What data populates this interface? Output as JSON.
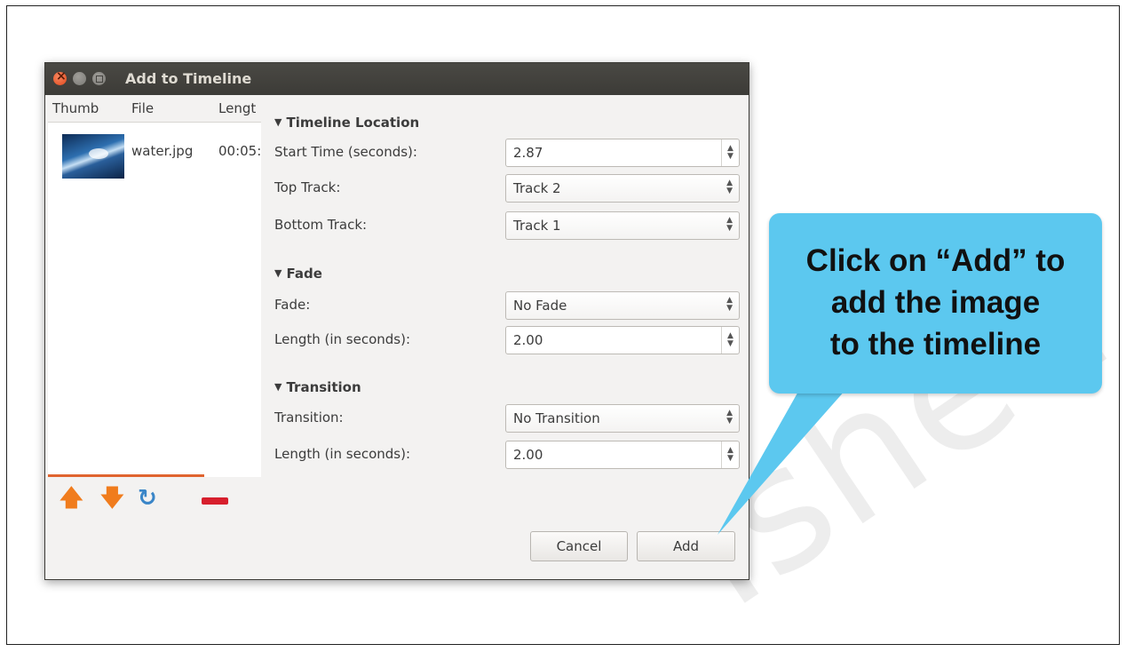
{
  "watermark": "Tshed",
  "dialog": {
    "title": "Add to Timeline",
    "file_list": {
      "columns": [
        "Thumb",
        "File",
        "Lengt"
      ],
      "rows": [
        {
          "file": "water.jpg",
          "length": "00:05:"
        }
      ]
    },
    "toolbar_icons": [
      "move-up-icon",
      "move-down-icon",
      "refresh-icon",
      "remove-icon"
    ],
    "sections": {
      "timeline_location": {
        "heading": "Timeline Location",
        "start_time_label": "Start Time (seconds):",
        "start_time_value": "2.87",
        "top_track_label": "Top Track:",
        "top_track_value": "Track 2",
        "bottom_track_label": "Bottom Track:",
        "bottom_track_value": "Track 1"
      },
      "fade": {
        "heading": "Fade",
        "fade_label": "Fade:",
        "fade_value": "No Fade",
        "length_label": "Length (in seconds):",
        "length_value": "2.00"
      },
      "transition": {
        "heading": "Transition",
        "transition_label": "Transition:",
        "transition_value": "No Transition",
        "length_label": "Length (in seconds):",
        "length_value": "2.00"
      }
    },
    "buttons": {
      "cancel": "Cancel",
      "add": "Add"
    }
  },
  "callout": {
    "line1": "Click on “Add” to",
    "line2": "add the image",
    "line3": "to the timeline",
    "color": "#5cc8ef"
  },
  "colors": {
    "titlebar": "#3c3b37",
    "dialog_bg": "#f3f2f1",
    "accent_orange": "#e0642f",
    "remove_red": "#d71f2d"
  }
}
